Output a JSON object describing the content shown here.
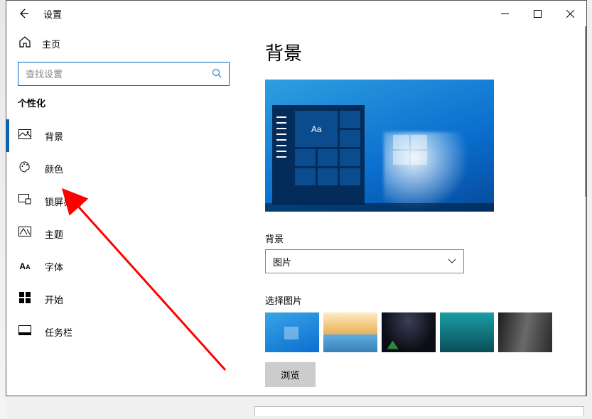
{
  "titlebar": {
    "title": "设置"
  },
  "sidebar": {
    "home": "主页",
    "search_placeholder": "查找设置",
    "section": "个性化",
    "items": [
      {
        "label": "背景"
      },
      {
        "label": "颜色"
      },
      {
        "label": "锁屏界面"
      },
      {
        "label": "主题"
      },
      {
        "label": "字体"
      },
      {
        "label": "开始"
      },
      {
        "label": "任务栏"
      }
    ]
  },
  "content": {
    "page_title": "背景",
    "preview_tile_text": "Aa",
    "field_background": "背景",
    "dropdown_value": "图片",
    "field_choose_image": "选择图片",
    "browse": "浏览"
  }
}
